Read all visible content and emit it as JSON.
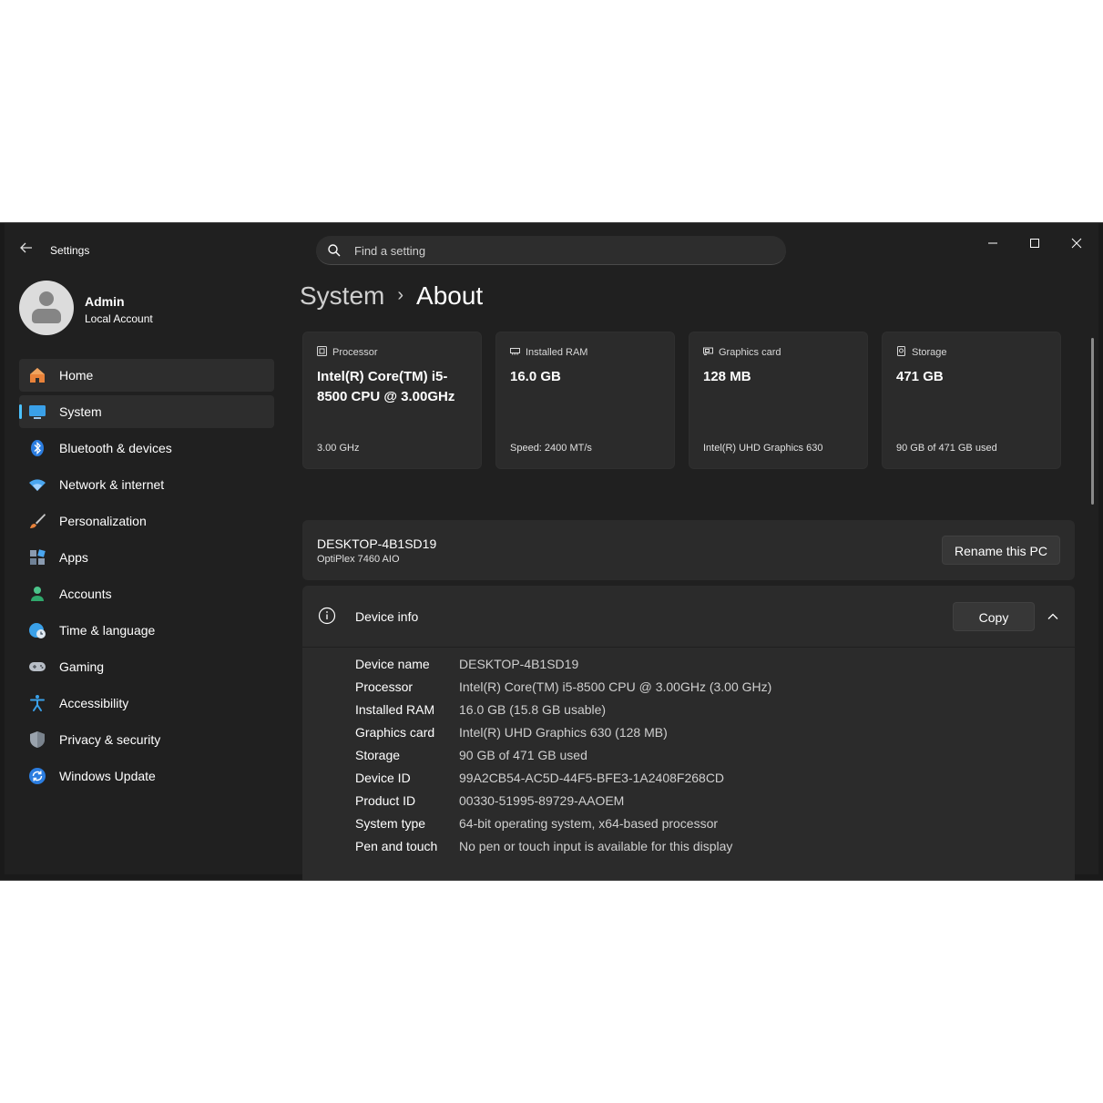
{
  "window": {
    "title": "Settings"
  },
  "search": {
    "placeholder": "Find a setting"
  },
  "user": {
    "name": "Admin",
    "account_type": "Local Account"
  },
  "sidebar": {
    "items": [
      {
        "label": "Home",
        "icon": "home-icon"
      },
      {
        "label": "System",
        "icon": "system-icon"
      },
      {
        "label": "Bluetooth & devices",
        "icon": "bluetooth-icon"
      },
      {
        "label": "Network & internet",
        "icon": "wifi-icon"
      },
      {
        "label": "Personalization",
        "icon": "brush-icon"
      },
      {
        "label": "Apps",
        "icon": "apps-icon"
      },
      {
        "label": "Accounts",
        "icon": "accounts-icon"
      },
      {
        "label": "Time & language",
        "icon": "globe-clock-icon"
      },
      {
        "label": "Gaming",
        "icon": "gamepad-icon"
      },
      {
        "label": "Accessibility",
        "icon": "accessibility-icon"
      },
      {
        "label": "Privacy & security",
        "icon": "shield-icon"
      },
      {
        "label": "Windows Update",
        "icon": "update-icon"
      }
    ]
  },
  "breadcrumb": {
    "parent": "System",
    "separator": "›",
    "current": "About"
  },
  "specs": [
    {
      "title": "Processor",
      "value": "Intel(R) Core(TM) i5-8500 CPU @ 3.00GHz",
      "sub": "3.00 GHz",
      "icon": "processor-icon"
    },
    {
      "title": "Installed RAM",
      "value": "16.0 GB",
      "sub": "Speed: 2400 MT/s",
      "icon": "ram-icon"
    },
    {
      "title": "Graphics card",
      "value": "128 MB",
      "sub": "Intel(R) UHD Graphics 630",
      "icon": "graphics-card-icon"
    },
    {
      "title": "Storage",
      "value": "471 GB",
      "sub": "90 GB of 471 GB used",
      "icon": "storage-icon"
    }
  ],
  "pc": {
    "name": "DESKTOP-4B1SD19",
    "model": "OptiPlex 7460 AIO",
    "rename_label": "Rename this PC"
  },
  "device_info": {
    "title": "Device info",
    "copy_label": "Copy",
    "rows": [
      {
        "label": "Device name",
        "value": "DESKTOP-4B1SD19"
      },
      {
        "label": "Processor",
        "value": "Intel(R) Core(TM) i5-8500 CPU @ 3.00GHz (3.00 GHz)"
      },
      {
        "label": "Installed RAM",
        "value": "16.0 GB (15.8 GB usable)"
      },
      {
        "label": "Graphics card",
        "value": "Intel(R) UHD Graphics 630 (128 MB)"
      },
      {
        "label": "Storage",
        "value": "90 GB of 471 GB used"
      },
      {
        "label": "Device ID",
        "value": "99A2CB54-AC5D-44F5-BFE3-1A2408F268CD"
      },
      {
        "label": "Product ID",
        "value": "00330-51995-89729-AAOEM"
      },
      {
        "label": "System type",
        "value": "64-bit operating system, x64-based processor"
      },
      {
        "label": "Pen and touch",
        "value": "No pen or touch input is available for this display"
      }
    ]
  },
  "colors": {
    "accent": "#4cc2ff",
    "background": "#202020",
    "card": "#2b2b2b"
  }
}
